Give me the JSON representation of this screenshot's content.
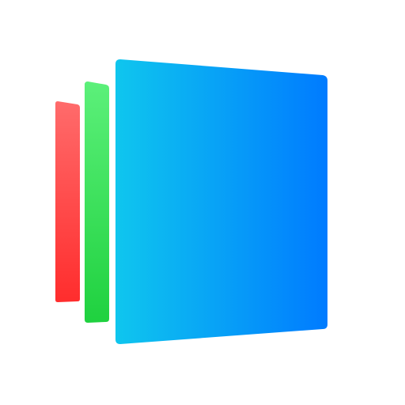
{
  "icon": {
    "name": "stacked-pages-app-icon",
    "layers": [
      {
        "name": "red-page-layer",
        "color_top": "#ff6b6b",
        "color_bottom": "#ff2d2d"
      },
      {
        "name": "green-page-layer",
        "color_top": "#5cf07a",
        "color_bottom": "#1fd13f"
      },
      {
        "name": "blue-page-layer",
        "color_left": "#0fc6ee",
        "color_right": "#007bff"
      }
    ],
    "background": "#ffffff"
  }
}
